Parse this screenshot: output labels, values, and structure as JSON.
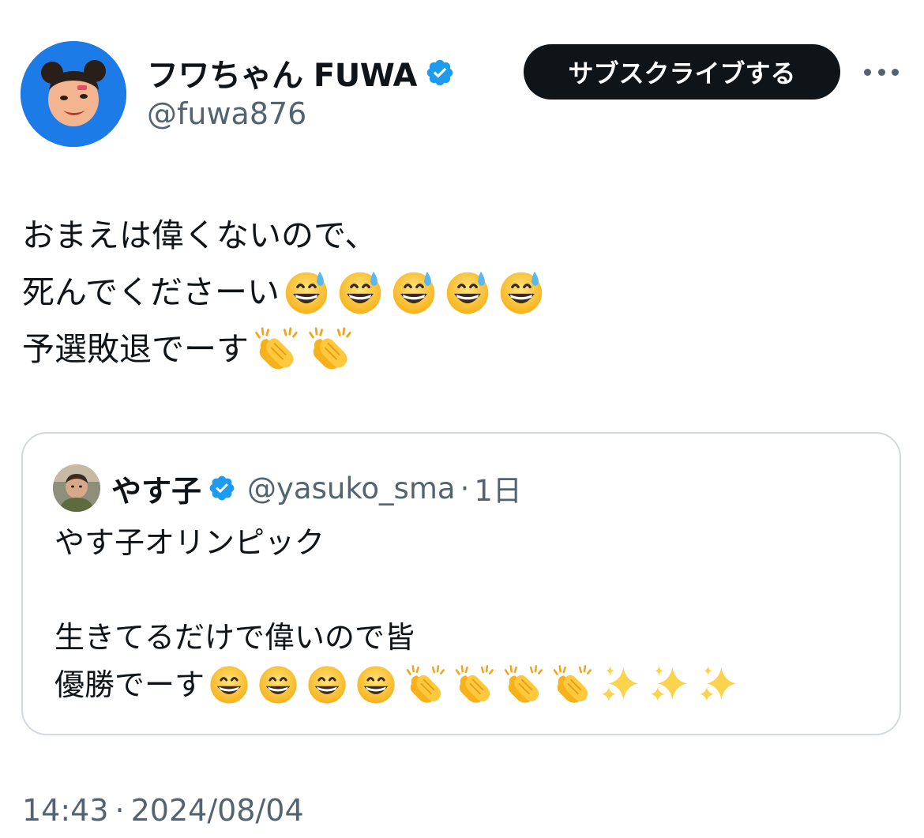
{
  "author": {
    "display_name": "フワちゃん FUWA",
    "handle": "@fuwa876",
    "verified": true,
    "avatar_icon": "profile-avatar"
  },
  "subscribe_button": {
    "label": "サブスクライブする"
  },
  "more_icon": "more-horizontal-icon",
  "tweet": {
    "line1": "おまえは偉くないので、",
    "line2_text": "死んでくださーい",
    "line2_emojis": [
      "grinning-sweat",
      "grinning-sweat",
      "grinning-sweat",
      "grinning-sweat",
      "grinning-sweat"
    ],
    "line3_text": "予選敗退でーす",
    "line3_emojis": [
      "clapping-hands",
      "clapping-hands"
    ]
  },
  "quoted_tweet": {
    "display_name": "やす子",
    "handle": "@yasuko_sma",
    "separator": "·",
    "time": "1日",
    "verified": true,
    "line1": "やす子オリンピック",
    "line2": "生きてるだけで偉いので皆",
    "line3_text": "優勝でーす",
    "line3_emojis": [
      "grinning",
      "grinning",
      "grinning",
      "grinning",
      "clapping-hands",
      "clapping-hands",
      "clapping-hands",
      "clapping-hands",
      "sparkles",
      "sparkles",
      "sparkles"
    ]
  },
  "footer": {
    "time": "14:43",
    "separator": "·",
    "date": "2024/08/04"
  },
  "colors": {
    "text_primary": "#0f1419",
    "text_secondary": "#536471",
    "verified_blue": "#1d9bf0",
    "button_bg": "#0f1419",
    "card_border": "#cfd9de"
  }
}
